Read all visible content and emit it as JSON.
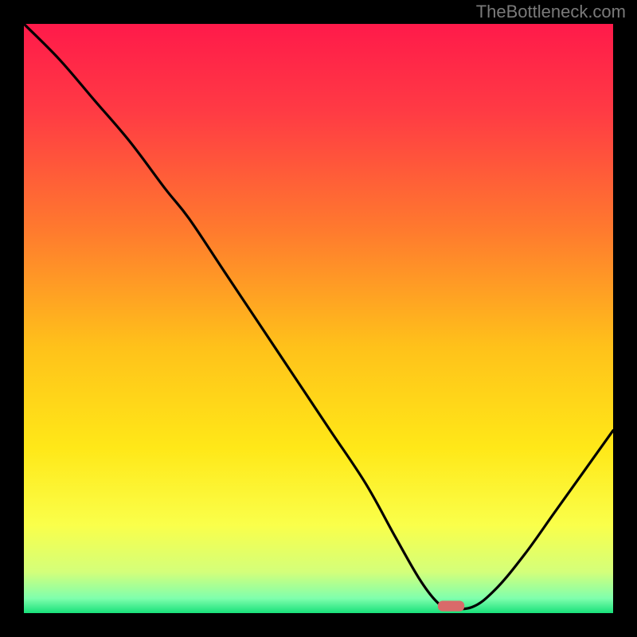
{
  "watermark": "TheBottleneck.com",
  "chart_data": {
    "type": "line",
    "title": "",
    "xlabel": "",
    "ylabel": "",
    "xlim": [
      0,
      100
    ],
    "ylim": [
      0,
      100
    ],
    "background_gradient": {
      "stops": [
        {
          "offset": 0.0,
          "color": "#ff1a4a"
        },
        {
          "offset": 0.15,
          "color": "#ff3b44"
        },
        {
          "offset": 0.35,
          "color": "#ff7a2e"
        },
        {
          "offset": 0.55,
          "color": "#ffc21a"
        },
        {
          "offset": 0.72,
          "color": "#ffe818"
        },
        {
          "offset": 0.85,
          "color": "#faff4a"
        },
        {
          "offset": 0.93,
          "color": "#d4ff7a"
        },
        {
          "offset": 0.975,
          "color": "#7fffad"
        },
        {
          "offset": 1.0,
          "color": "#18e07a"
        }
      ]
    },
    "series": [
      {
        "name": "bottleneck-curve",
        "x": [
          0,
          6,
          12,
          18,
          24,
          28,
          34,
          40,
          46,
          52,
          58,
          63,
          67,
          70,
          72,
          76,
          80,
          85,
          90,
          95,
          100
        ],
        "y": [
          100,
          94,
          87,
          80,
          72,
          67,
          58,
          49,
          40,
          31,
          22,
          13,
          6,
          2,
          1,
          1,
          4,
          10,
          17,
          24,
          31
        ]
      }
    ],
    "marker": {
      "x": 72.5,
      "y": 1.2,
      "color": "#d96a6a",
      "shape": "rounded-rect",
      "width": 4.5,
      "height": 1.8
    }
  }
}
